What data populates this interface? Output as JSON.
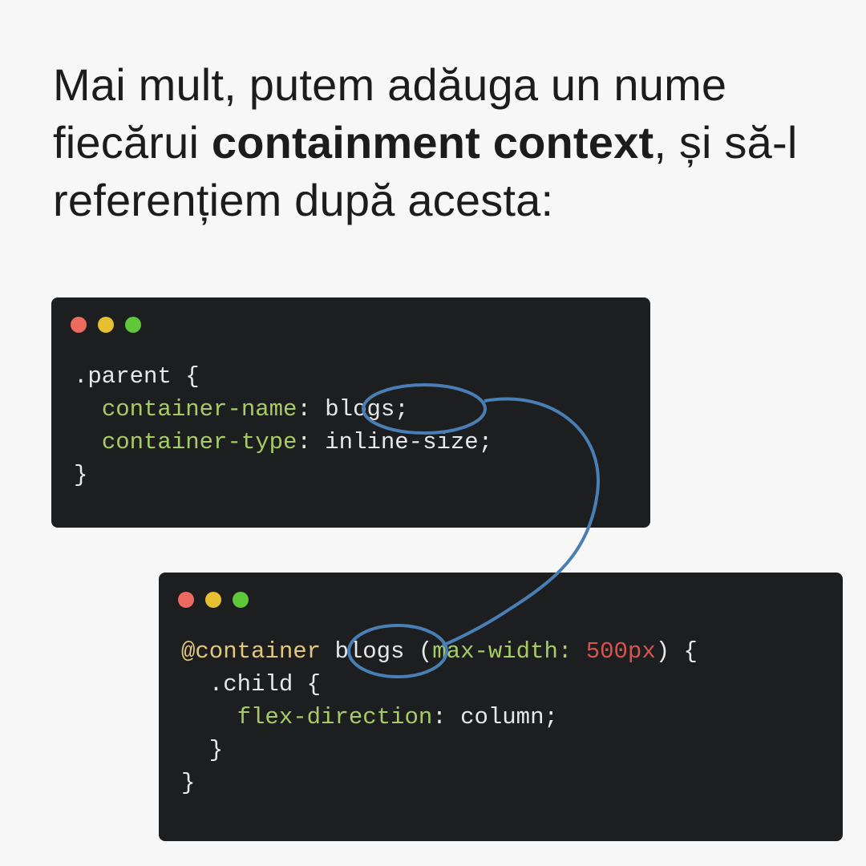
{
  "heading": {
    "part1": "Mai mult, putem adăuga un nume fiecărui ",
    "bold": "containment context",
    "part2": ", și să-l referențiem după acesta:"
  },
  "code_block_1": {
    "line1": ".parent {",
    "line2_indent": "  ",
    "line2_prop": "container-name",
    "line2_sep": ": ",
    "line2_value": "blogs;",
    "line3_indent": "  ",
    "line3_prop": "container-type",
    "line3_sep": ": ",
    "line3_value": "inline-size;",
    "line4": "}"
  },
  "code_block_2": {
    "line1_at": "@container",
    "line1_space": " ",
    "line1_name": "blogs",
    "line1_open": " (",
    "line1_prop": "max-width:",
    "line1_space2": " ",
    "line1_num": "500px",
    "line1_close": ") {",
    "line2": "  .child {",
    "line3_indent": "    ",
    "line3_prop": "flex-direction",
    "line3_value": ": column;",
    "line4": "  }",
    "line5": "}"
  },
  "colors": {
    "background": "#f7f7f7",
    "code_bg": "#1d1e20",
    "property": "#a7cc64",
    "at_rule": "#e3c77a",
    "number": "#d9534f",
    "highlight": "#4a7fb5",
    "dot_red": "#ed6a5e",
    "dot_yellow": "#e6c031",
    "dot_green": "#5fc83a"
  }
}
